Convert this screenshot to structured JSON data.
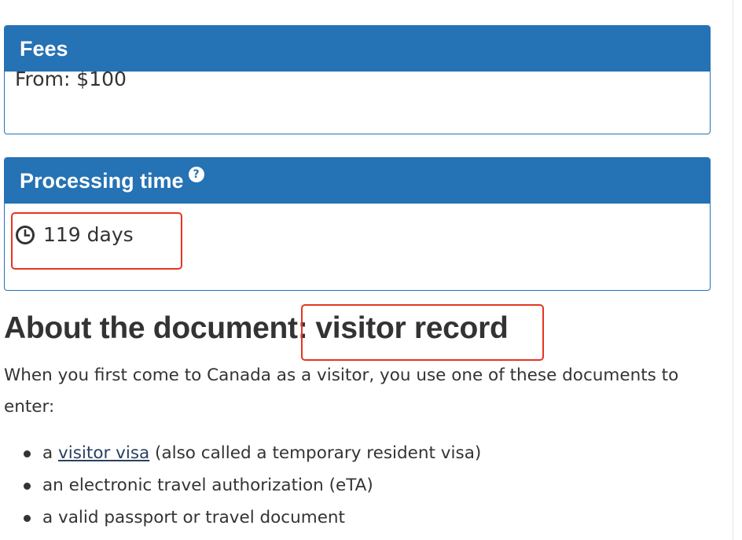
{
  "fees": {
    "heading": "Fees",
    "value": "From: $100"
  },
  "processing": {
    "heading": "Processing time",
    "help_icon": "question-circle-icon",
    "clock_icon": "clock-icon",
    "value": "119 days"
  },
  "about": {
    "heading_prefix": "About the document:",
    "document_name": "visitor record",
    "intro": "When you first come to Canada as a visitor, you use one of these documents to enter:",
    "items": [
      {
        "prefix": "a ",
        "link": "visitor visa",
        "suffix": " (also called a temporary resident visa)"
      },
      {
        "text": "an electronic travel authorization (eTA)"
      },
      {
        "text": "a valid passport or travel document"
      }
    ]
  },
  "colors": {
    "panel_header": "#2572b4",
    "highlight_border": "#e8341f",
    "link": "#284162",
    "text": "#333333"
  }
}
